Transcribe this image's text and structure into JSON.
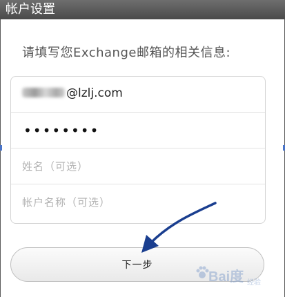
{
  "window": {
    "title": "帐户设置"
  },
  "instruction": "请填写您Exchange邮箱的相关信息:",
  "form": {
    "email_domain": "@lzlj.com",
    "password_mask": "••••••••",
    "name_placeholder": "姓名（可选）",
    "account_name_placeholder": "帐户名称（可选）"
  },
  "next_button": {
    "label": "下一步"
  },
  "colors": {
    "arrow": "#1a3e8f",
    "titlebar": "#5a5a5a"
  },
  "watermark": {
    "brand": "Bai度",
    "sub": "经验"
  }
}
